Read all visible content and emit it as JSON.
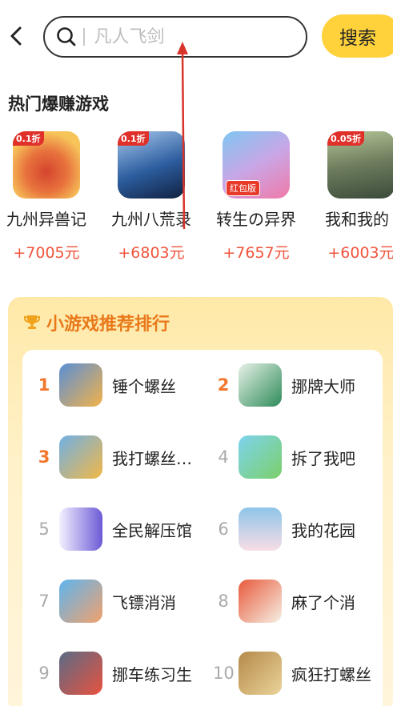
{
  "header": {
    "back_icon": "chevron-left-icon",
    "search_placeholder": "凡人飞剑",
    "search_button": "搜索"
  },
  "hot_games": {
    "title": "热门爆赚游戏",
    "items": [
      {
        "name": "九州异兽记",
        "reward": "+7005元",
        "tag": "0.1折",
        "colors": [
          "#f7c45a",
          "#d4452e"
        ]
      },
      {
        "name": "九州八荒录",
        "reward": "+6803元",
        "tag": "0.1折",
        "colors": [
          "#2c5d9e",
          "#a8c8ef"
        ]
      },
      {
        "name": "转生の异界",
        "reward": "+7657元",
        "badge": "红包版",
        "colors": [
          "#7fc6f2",
          "#f07aa8"
        ]
      },
      {
        "name": "我和我的",
        "reward": "+6003元",
        "tag": "0.05折",
        "colors": [
          "#3a4a3a",
          "#b5c79a"
        ]
      }
    ]
  },
  "ranking": {
    "title": "小游戏推荐排行",
    "trophy_icon": "trophy-icon",
    "accent": "#e8791a",
    "items": [
      {
        "rank": "1",
        "name": "锤个螺丝",
        "colors": [
          "#f3b24a",
          "#5a8fd6"
        ]
      },
      {
        "rank": "2",
        "name": "挪牌大师",
        "colors": [
          "#2e8c5a",
          "#e7f1e7"
        ]
      },
      {
        "rank": "3",
        "name": "我打螺丝…",
        "colors": [
          "#f2b846",
          "#6fb0e6"
        ]
      },
      {
        "rank": "4",
        "name": "拆了我吧",
        "colors": [
          "#7dd3ee",
          "#7cd06a"
        ]
      },
      {
        "rank": "5",
        "name": "全民解压馆",
        "colors": [
          "#6b5bd6",
          "#f4f0ff"
        ]
      },
      {
        "rank": "6",
        "name": "我的花园",
        "colors": [
          "#f8dde6",
          "#8ec5e8"
        ]
      },
      {
        "rank": "7",
        "name": "飞镖消消",
        "colors": [
          "#5db5ef",
          "#f2a16c"
        ]
      },
      {
        "rank": "8",
        "name": "麻了个消",
        "colors": [
          "#e85a3c",
          "#f6f0e4"
        ]
      },
      {
        "rank": "9",
        "name": "挪车练习生",
        "colors": [
          "#5a6b86",
          "#e8523e"
        ]
      },
      {
        "rank": "10",
        "name": "疯狂打螺丝",
        "colors": [
          "#b48a4a",
          "#ebd39a"
        ]
      }
    ]
  }
}
